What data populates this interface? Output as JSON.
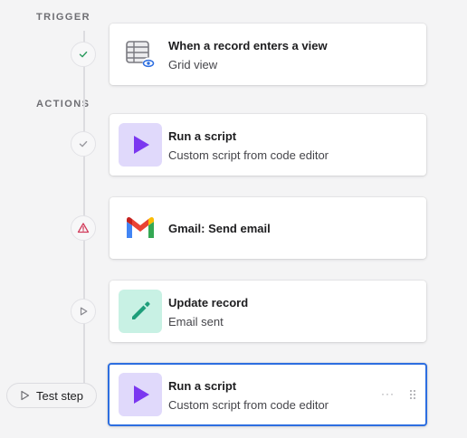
{
  "sections": {
    "trigger_label": "TRIGGER",
    "actions_label": "ACTIONS"
  },
  "trigger": {
    "title": "When a record enters a view",
    "subtitle": "Grid view",
    "icon": "grid-view-icon",
    "status": "checkmark-icon"
  },
  "actions": [
    {
      "title": "Run a script",
      "subtitle": "Custom script from code editor",
      "icon": "play-icon",
      "tile_color": "#e0d9fb",
      "status": "checkmark-icon"
    },
    {
      "title": "Gmail: Send email",
      "subtitle": "",
      "icon": "gmail-icon",
      "tile_color": "#ffffff",
      "status": "warning-icon"
    },
    {
      "title": "Update record",
      "subtitle": "Email sent",
      "icon": "pencil-icon",
      "tile_color": "#c8f1e4",
      "status": "play-outline-icon"
    },
    {
      "title": "Run a script",
      "subtitle": "Custom script from code editor",
      "icon": "play-icon",
      "tile_color": "#e0d9fb",
      "status": "none",
      "selected": true
    }
  ],
  "test_step": {
    "label": "Test step"
  },
  "colors": {
    "accent": "#2d6ee0",
    "script_purple": "#7b38f0",
    "update_green": "#1e9e7a",
    "warning_red": "#d13b5a"
  }
}
